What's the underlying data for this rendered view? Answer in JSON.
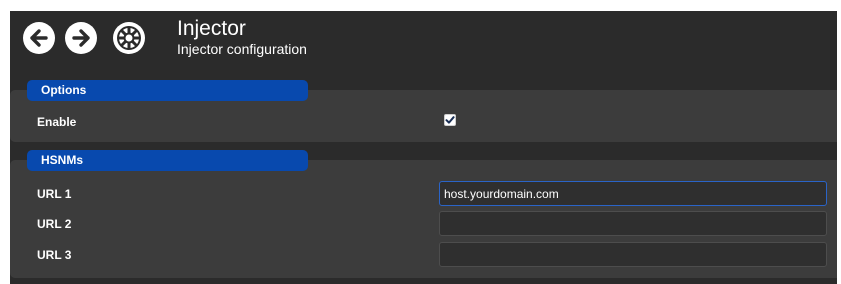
{
  "header": {
    "title": "Injector",
    "subtitle": "Injector configuration",
    "icons": [
      "arrow-left-icon",
      "arrow-right-icon",
      "settings-wheel-icon"
    ]
  },
  "options": {
    "tab_label": "Options",
    "enable_label": "Enable",
    "enable_checked": true
  },
  "hsnms": {
    "tab_label": "HSNMs",
    "url1_label": "URL 1",
    "url1_value": "host.yourdomain.com",
    "url2_label": "URL 2",
    "url2_value": "",
    "url3_label": "URL 3",
    "url3_value": ""
  },
  "colors": {
    "panel_bg": "#2b2b2b",
    "section_bg": "#3c3c3c",
    "tab_blue": "#0849ae",
    "focus_border": "#2a64c8"
  }
}
